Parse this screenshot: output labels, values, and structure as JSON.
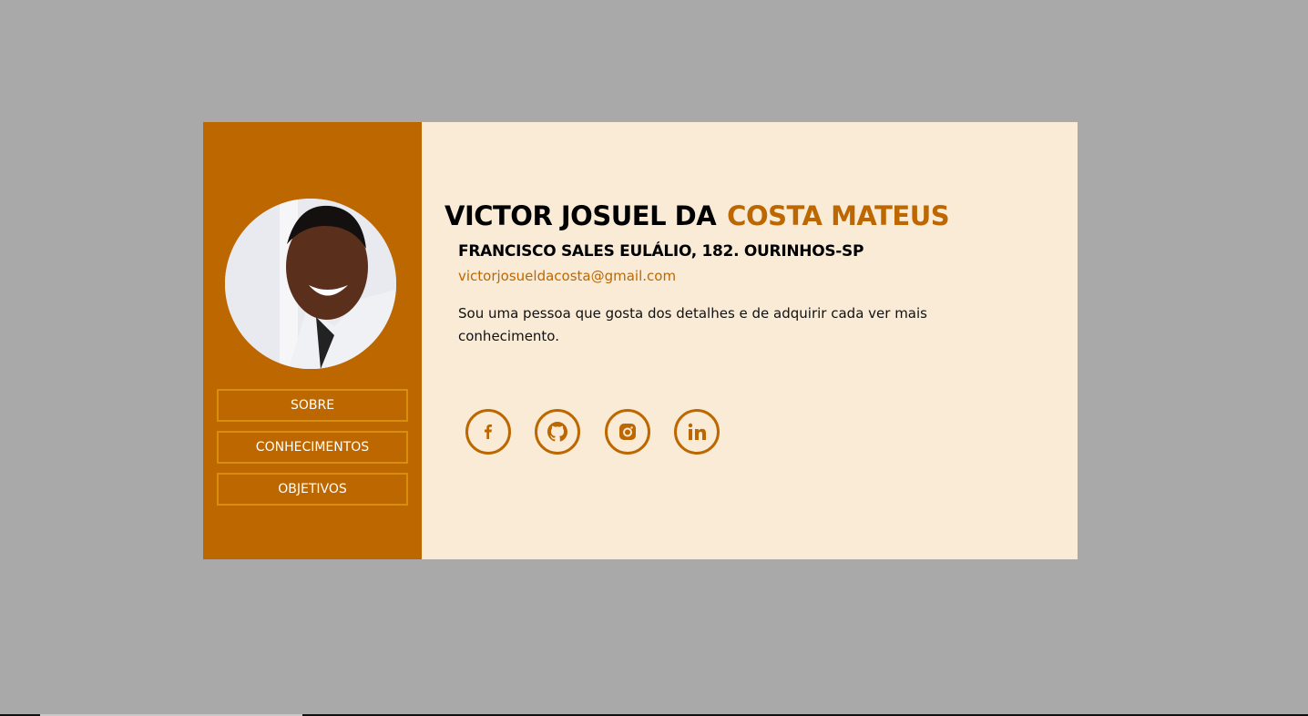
{
  "profile": {
    "name_first": "VICTOR JOSUEL DA",
    "name_last": "COSTA MATEUS",
    "address": "FRANCISCO SALES EULÁLIO, 182. OURINHOS-SP",
    "email": "victorjosueldacosta@gmail.com",
    "bio": "Sou uma pessoa que gosta dos detalhes e de adquirir cada ver mais conhecimento."
  },
  "nav": [
    {
      "label": "SOBRE"
    },
    {
      "label": "CONHECIMENTOS"
    },
    {
      "label": "OBJETIVOS"
    }
  ],
  "social": [
    "facebook-icon",
    "github-icon",
    "instagram-icon",
    "linkedin-icon"
  ],
  "colors": {
    "accent": "#bd6700",
    "background": "#faebd7",
    "page": "#a9a9a9"
  }
}
